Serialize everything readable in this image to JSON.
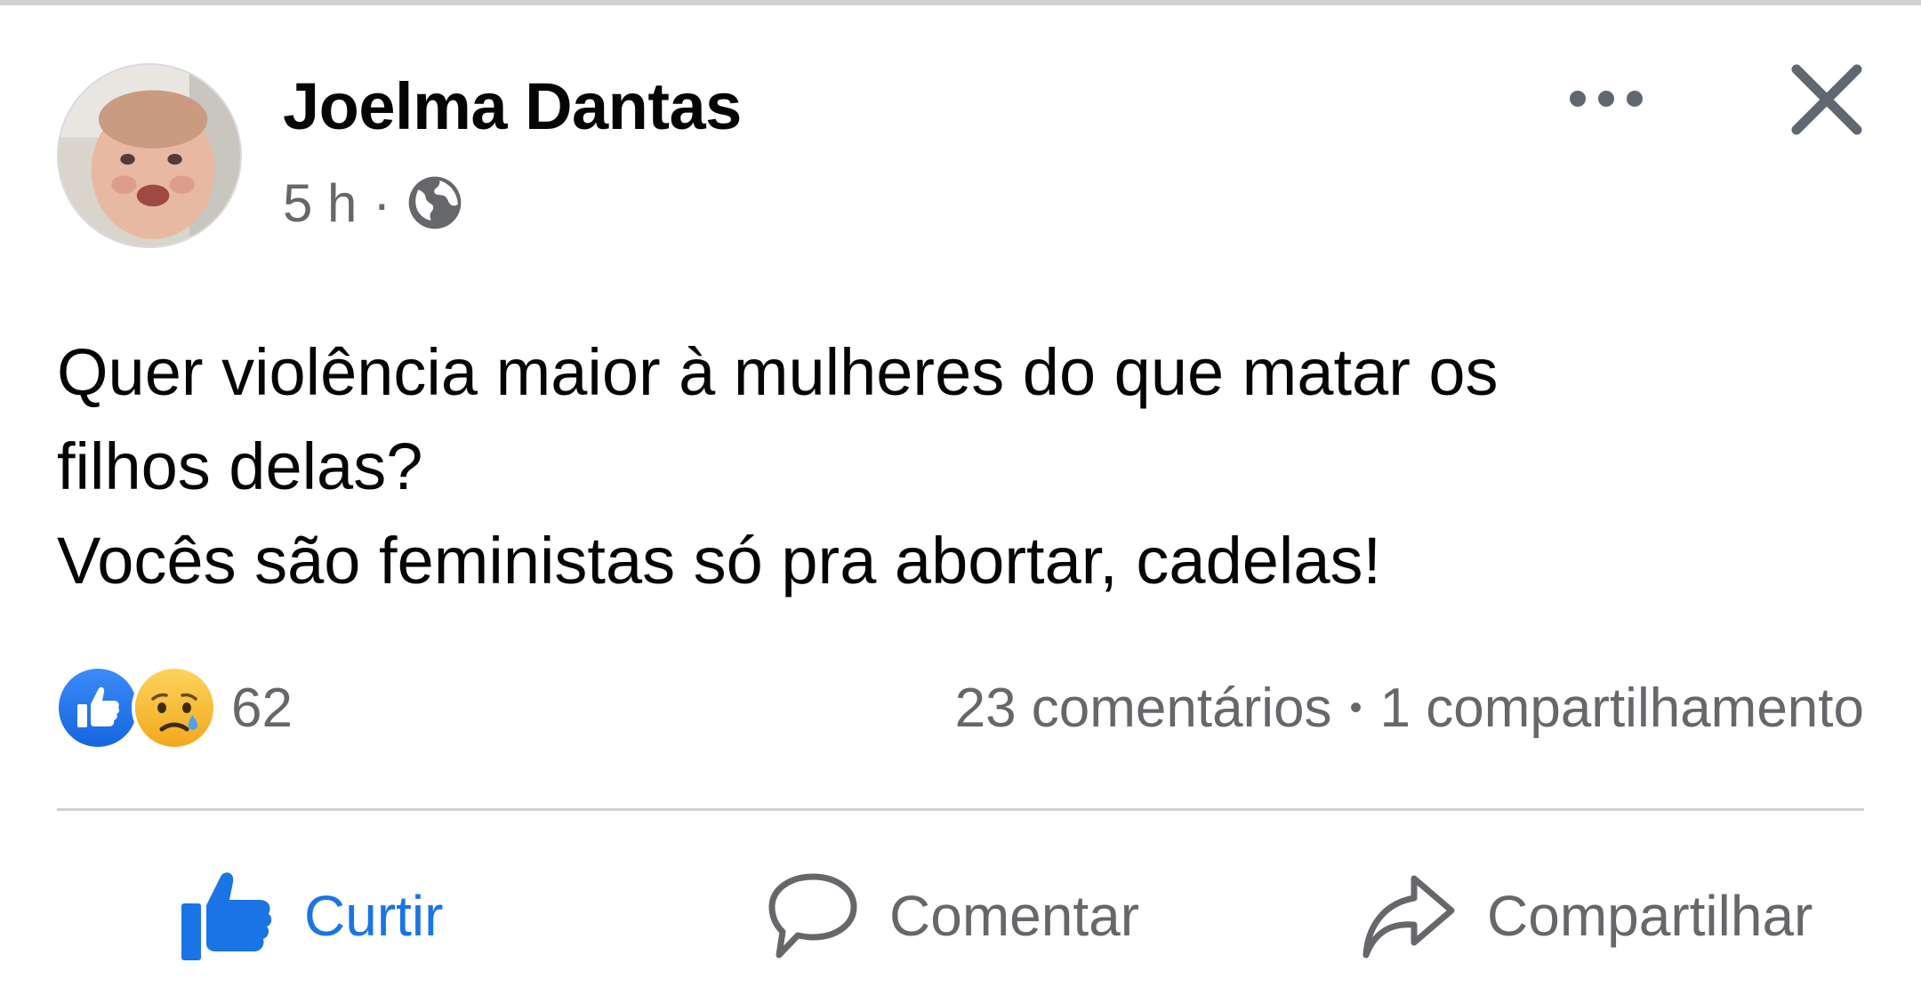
{
  "post": {
    "author": "Joelma Dantas",
    "time": "5 h",
    "separator": "·",
    "audience_icon": "globe-icon",
    "text_lines": [
      "Quer violência maior à mulheres do que matar os",
      "filhos delas?",
      "Vocês são feministas só pra abortar, cadelas!"
    ]
  },
  "stats": {
    "reaction_icons": [
      "like-reaction-icon",
      "sad-reaction-icon"
    ],
    "reaction_count": "62",
    "comments": "23 comentários",
    "separator": "•",
    "shares": "1 compartilhamento"
  },
  "actions": {
    "like": "Curtir",
    "comment": "Comentar",
    "share": "Compartilhar"
  },
  "colors": {
    "like_blue": "#1b74e4",
    "secondary_text": "#65676b",
    "divider": "#ced0d4",
    "sad_yellow": "#f7b125"
  }
}
